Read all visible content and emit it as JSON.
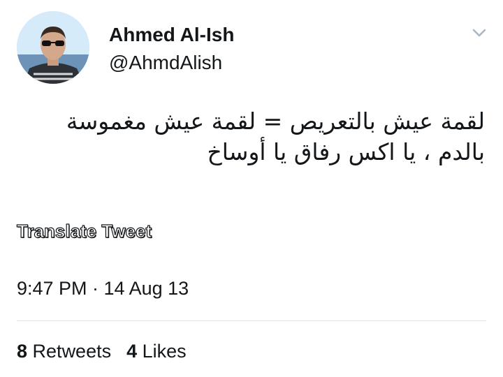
{
  "user": {
    "name": "Ahmed Al-Ish",
    "handle": "@AhmdAlish"
  },
  "tweet": {
    "text": "لقمة عيش بالتعريص = لقمة عيش مغموسة بالدم ، يا اكس رفاق يا أوساخ",
    "translate_label": "Translate Tweet",
    "timestamp": "9:47 PM · 14 Aug 13"
  },
  "stats": {
    "retweets_count": "8",
    "retweets_label": "Retweets",
    "likes_count": "4",
    "likes_label": "Likes"
  },
  "icons": {
    "menu": "chevron-down-icon",
    "avatar": "profile-photo"
  },
  "colors": {
    "text": "#14171a",
    "muted": "#aab8c2",
    "divider": "#dfe3e6"
  }
}
